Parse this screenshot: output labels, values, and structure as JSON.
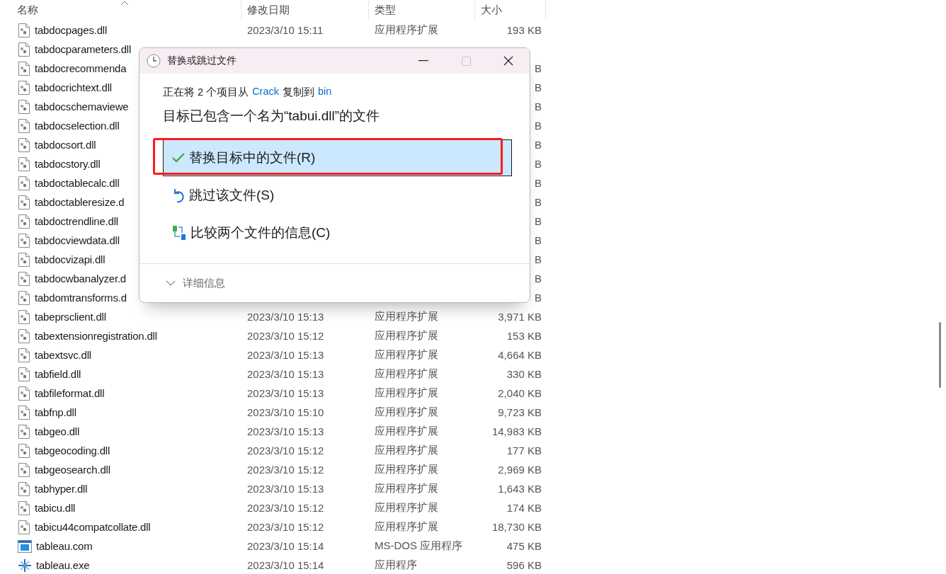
{
  "columns": [
    {
      "label": "名称",
      "sorted": true
    },
    {
      "label": "修改日期",
      "sorted": false
    },
    {
      "label": "类型",
      "sorted": false
    },
    {
      "label": "大小",
      "sorted": false
    }
  ],
  "files": [
    {
      "kind": "dll",
      "name": "tabdocpages.dll",
      "date": "2023/3/10 15:11",
      "type": "应用程序扩展",
      "size": "193 KB"
    },
    {
      "kind": "dll",
      "name": "tabdocparameters.dll"
    },
    {
      "kind": "dll",
      "name": "tabdocrecommenda",
      "size": "B"
    },
    {
      "kind": "dll",
      "name": "tabdocrichtext.dll",
      "size": "B"
    },
    {
      "kind": "dll",
      "name": "tabdocschemaviewe",
      "size": "B"
    },
    {
      "kind": "dll",
      "name": "tabdocselection.dll",
      "size": "B"
    },
    {
      "kind": "dll",
      "name": "tabdocsort.dll",
      "size": "B"
    },
    {
      "kind": "dll",
      "name": "tabdocstory.dll",
      "size": "B"
    },
    {
      "kind": "dll",
      "name": "tabdoctablecalc.dll",
      "size": "B"
    },
    {
      "kind": "dll",
      "name": "tabdoctableresize.d",
      "size": "B"
    },
    {
      "kind": "dll",
      "name": "tabdoctrendline.dll",
      "size": "B"
    },
    {
      "kind": "dll",
      "name": "tabdocviewdata.dll",
      "size": "B"
    },
    {
      "kind": "dll",
      "name": "tabdocvizapi.dll",
      "size": "B"
    },
    {
      "kind": "dll",
      "name": "tabdocwbanalyzer.d",
      "size": "B"
    },
    {
      "kind": "dll",
      "name": "tabdomtransforms.d",
      "size": "B"
    },
    {
      "kind": "dll",
      "name": "tabeprsclient.dll",
      "date": "2023/3/10 15:13",
      "type": "应用程序扩展",
      "size": "3,971 KB"
    },
    {
      "kind": "dll",
      "name": "tabextensionregistration.dll",
      "date": "2023/3/10 15:12",
      "type": "应用程序扩展",
      "size": "153 KB"
    },
    {
      "kind": "dll",
      "name": "tabextsvc.dll",
      "date": "2023/3/10 15:13",
      "type": "应用程序扩展",
      "size": "4,664 KB"
    },
    {
      "kind": "dll",
      "name": "tabfield.dll",
      "date": "2023/3/10 15:13",
      "type": "应用程序扩展",
      "size": "330 KB"
    },
    {
      "kind": "dll",
      "name": "tabfileformat.dll",
      "date": "2023/3/10 15:13",
      "type": "应用程序扩展",
      "size": "2,040 KB"
    },
    {
      "kind": "dll",
      "name": "tabfnp.dll",
      "date": "2023/3/10 15:10",
      "type": "应用程序扩展",
      "size": "9,723 KB"
    },
    {
      "kind": "dll",
      "name": "tabgeo.dll",
      "date": "2023/3/10 15:13",
      "type": "应用程序扩展",
      "size": "14,983 KB"
    },
    {
      "kind": "dll",
      "name": "tabgeocoding.dll",
      "date": "2023/3/10 15:12",
      "type": "应用程序扩展",
      "size": "177 KB"
    },
    {
      "kind": "dll",
      "name": "tabgeosearch.dll",
      "date": "2023/3/10 15:12",
      "type": "应用程序扩展",
      "size": "2,969 KB"
    },
    {
      "kind": "dll",
      "name": "tabhyper.dll",
      "date": "2023/3/10 15:13",
      "type": "应用程序扩展",
      "size": "1,643 KB"
    },
    {
      "kind": "dll",
      "name": "tabicu.dll",
      "date": "2023/3/10 15:12",
      "type": "应用程序扩展",
      "size": "174 KB"
    },
    {
      "kind": "dll",
      "name": "tabicu44compatcollate.dll",
      "date": "2023/3/10 15:12",
      "type": "应用程序扩展",
      "size": "18,730 KB"
    },
    {
      "kind": "com",
      "name": "tableau.com",
      "date": "2023/3/10 15:14",
      "type": "MS-DOS 应用程序",
      "size": "475 KB"
    },
    {
      "kind": "exe",
      "name": "tableau.exe",
      "date": "2023/3/10 15:14",
      "type": "应用程序",
      "size": "596 KB"
    }
  ],
  "dialog": {
    "title": "替换或跳过文件",
    "copy_line": [
      {
        "text": "正在将 2 个项目从",
        "kind": "text"
      },
      {
        "text": "Crack",
        "kind": "link"
      },
      {
        "text": "复制到",
        "kind": "text"
      },
      {
        "text": "bin",
        "kind": "link"
      }
    ],
    "heading": "目标已包含一个名为“tabui.dll”的文件",
    "options": [
      {
        "kind": "replace",
        "label": "替换目标中的文件(R)",
        "selected": true
      },
      {
        "kind": "skip",
        "label": "跳过该文件(S)",
        "selected": false
      },
      {
        "kind": "compare",
        "label": "比较两个文件的信息(C)",
        "selected": false
      }
    ],
    "details": {
      "label": "详细信息",
      "expanded": false
    }
  }
}
